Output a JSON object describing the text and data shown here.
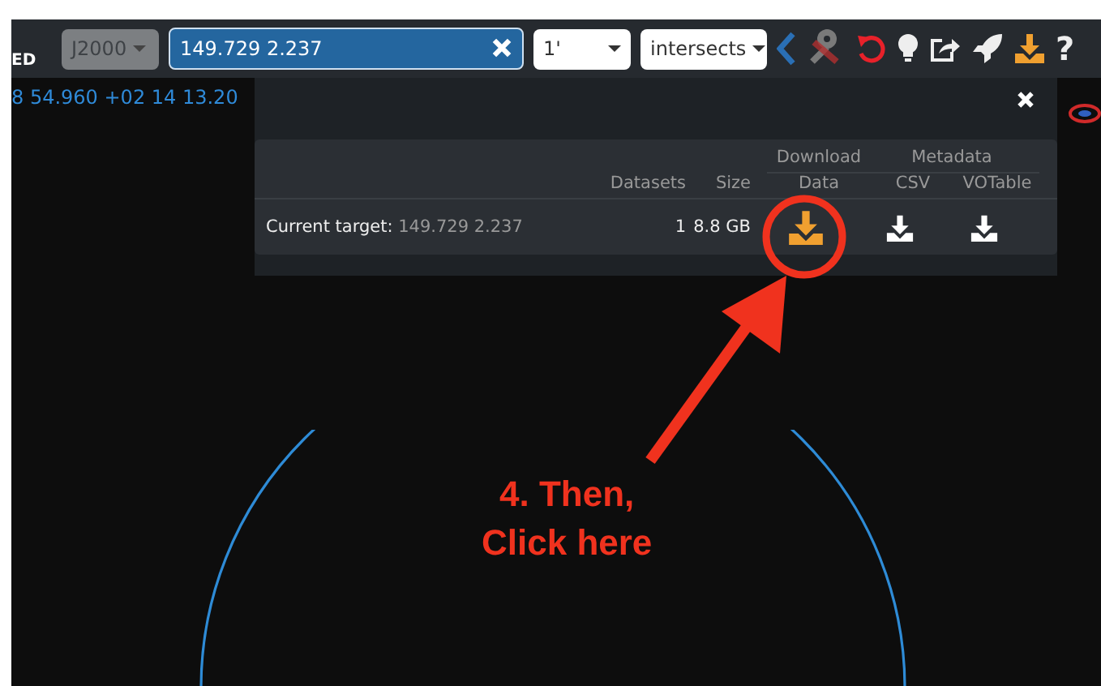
{
  "toolbar": {
    "label": "ED",
    "frame_select": "J2000",
    "search": {
      "value": "149.729 2.237"
    },
    "radius_select": "1'",
    "mode_select": "intersects",
    "help": "?"
  },
  "coordinates": "8 54.960 +02 14 13.20",
  "panel": {
    "headers": {
      "datasets": "Datasets",
      "size": "Size",
      "download": "Download",
      "data": "Data",
      "metadata": "Metadata",
      "csv": "CSV",
      "votable": "VOTable"
    },
    "rows": [
      {
        "label": "Current target:",
        "target": "149.729 2.237",
        "datasets": "1",
        "size": "8.8 GB"
      }
    ]
  },
  "annotation": {
    "lines": [
      "4. Then,",
      "Click here"
    ]
  }
}
